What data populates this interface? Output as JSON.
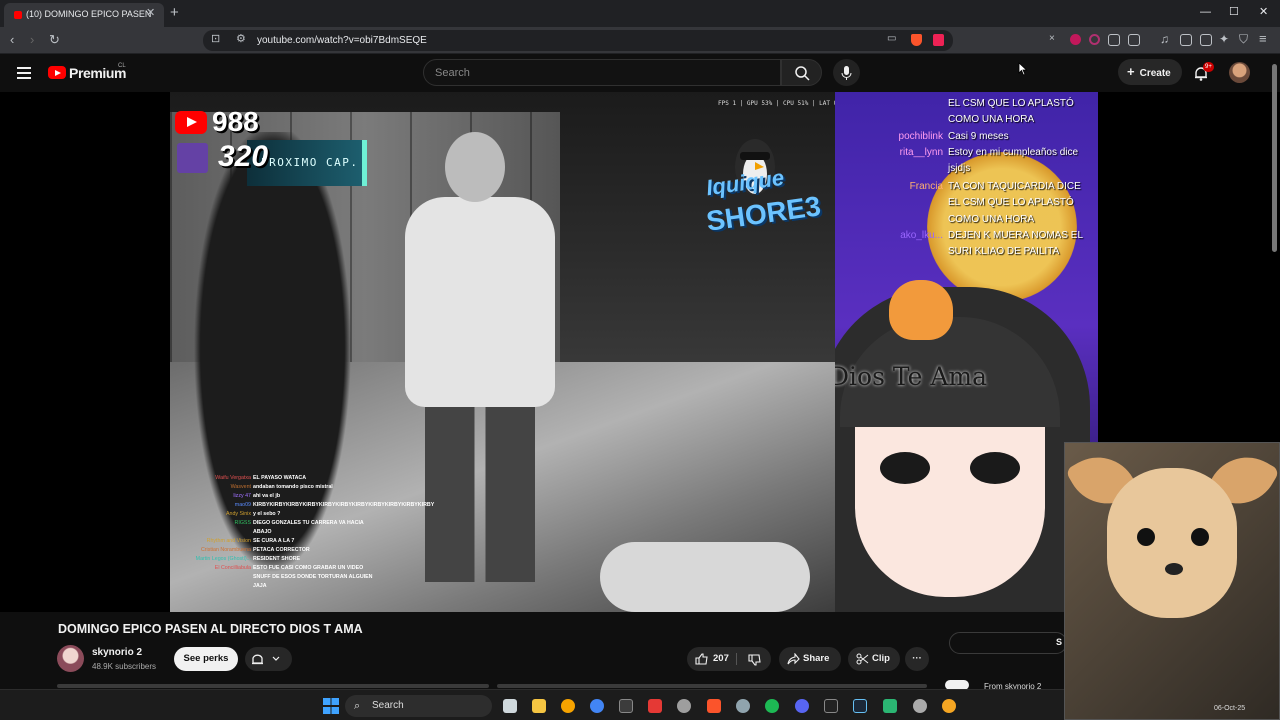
{
  "browser": {
    "tab_title": "(10) DOMINGO EPICO PASEN",
    "url": "youtube.com/watch?v=obi7BdmSEQE",
    "new_tab": "+",
    "tab_close": "✕",
    "win_minimize": "—",
    "win_maximize": "☐",
    "win_close": "✕"
  },
  "youtube_header": {
    "brand": "Premium",
    "region": "CL",
    "search_placeholder": "Search",
    "create_label": "Create",
    "notifications_badge": "9+"
  },
  "player": {
    "youtube_count": "988",
    "twitch_count": "320",
    "next_chapter": "PROXIMO CAP.",
    "stats": "FPS 1 | GPU 53% | CPU 51% | LAT 0ms",
    "event_line1": "Iquique",
    "event_line2": "SHORE3",
    "banner": "Dios Te Ama",
    "overlay_chat": [
      {
        "user": "Waifu Vergatxa",
        "color": "#e05050",
        "msg": "EL PAYASO WATACA"
      },
      {
        "user": "Wasvent",
        "color": "#c07030",
        "msg": "andaban tomando pisco mistral"
      },
      {
        "user": "lizzy 47",
        "color": "#a070ff",
        "msg": "ahi va el jb"
      },
      {
        "user": "mao09",
        "color": "#5a8cff",
        "msg": "KIRBYKIRBYKIRBYKIRBYKIRBYKIRBYKIRBYKIRBYKIRBYKIRBYKIRBY"
      },
      {
        "user": "Andy Sinix",
        "color": "#d0a030",
        "msg": "y el sebo ?"
      },
      {
        "user": "RIGSS",
        "color": "#30c060",
        "msg": "DIEGO GONZALES TU CARRERA VA HACIA ABAJO"
      },
      {
        "user": "Rhythm and Vision",
        "color": "#d0a030",
        "msg": "SE CURA A LA 7"
      },
      {
        "user": "Cristian Norambuena",
        "color": "#d07030",
        "msg": "PETACA CORRECTOR"
      },
      {
        "user": "Martin Legos (Ghostl)...",
        "color": "#30c0b0",
        "msg": "RESIDENT SHORE"
      },
      {
        "user": "El Concilliabula",
        "color": "#e05050",
        "msg": "ESTO FUE CASI COMO GRABAR UN VIDEO SNUFF DE ESOS DONDE TORTURAN ALGUIEN JAJA"
      }
    ],
    "stream_chat": [
      {
        "user": "",
        "color": "#ffffff",
        "text": "EL CSM QUE LO APLASTÓ COMO UNA HORA"
      },
      {
        "user": "pochiblink",
        "color": "#ff9df0",
        "text": "Casi 9 meses"
      },
      {
        "user": "rita__lynn",
        "color": "#ff9df0",
        "text": "Estoy en mi cumpleaños dice jsjdjs"
      },
      {
        "user": "Francia",
        "color": "#ffb070",
        "text": "TA CON TAQUICARDIA DICE EL CSM QUE LO APLASTÓ COMO UNA HORA"
      },
      {
        "user": "ako_lku...",
        "color": "#9a66ff",
        "text": "DEJEN K MUERA NOMAS EL SURI KLIAO DE PAILITA"
      }
    ]
  },
  "video": {
    "title": "DOMINGO EPICO PASEN AL DIRECTO DIOS T AMA",
    "channel_name": "skynorio 2",
    "subscribers": "48.9K subscribers",
    "perks_label": "See perks",
    "like_count": "207",
    "share_label": "Share",
    "clip_label": "Clip",
    "more_label": "···",
    "right_panel_s": "S",
    "from_label": "From skynorio 2"
  },
  "taskbar": {
    "search_label": "Search",
    "date": "06-Oct-25"
  },
  "colors": {
    "youtube_red": "#ff0000",
    "twitch_purple": "#6441a5",
    "background": "#0f0f0f"
  }
}
